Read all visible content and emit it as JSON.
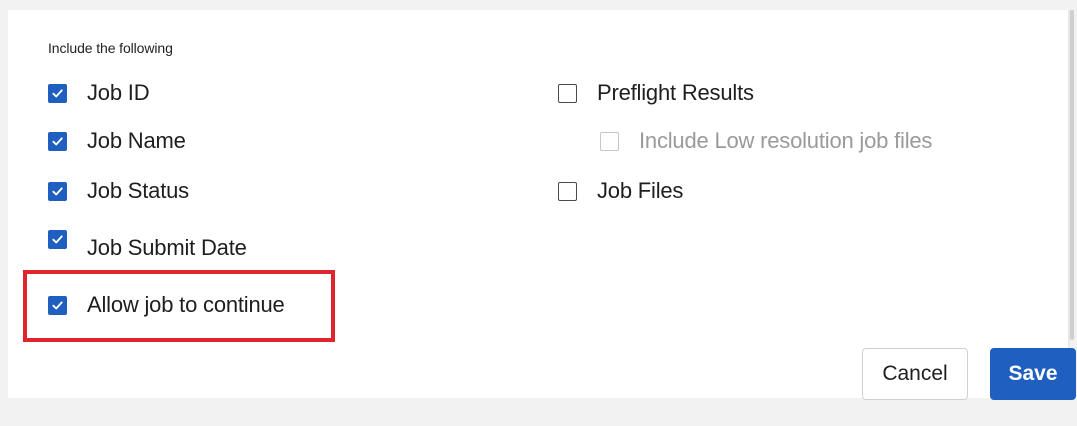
{
  "section": {
    "label": "Include the following"
  },
  "options_left": [
    {
      "label": "Job ID",
      "checked": true
    },
    {
      "label": "Job Name",
      "checked": true
    },
    {
      "label": "Job Status",
      "checked": true
    },
    {
      "label": "Job Submit Date",
      "checked": true
    },
    {
      "label": "Allow job to continue",
      "checked": true
    }
  ],
  "options_right": [
    {
      "label": "Preflight Results",
      "checked": false
    },
    {
      "label": "Include Low resolution job files",
      "checked": false,
      "disabled": true
    },
    {
      "label": "Job Files",
      "checked": false
    }
  ],
  "buttons": {
    "cancel_label": "Cancel",
    "save_label": "Save"
  },
  "colors": {
    "accent": "#1f5fbf",
    "highlight": "#e0242e"
  },
  "icons": {
    "checkbox_checked": "check-icon"
  }
}
